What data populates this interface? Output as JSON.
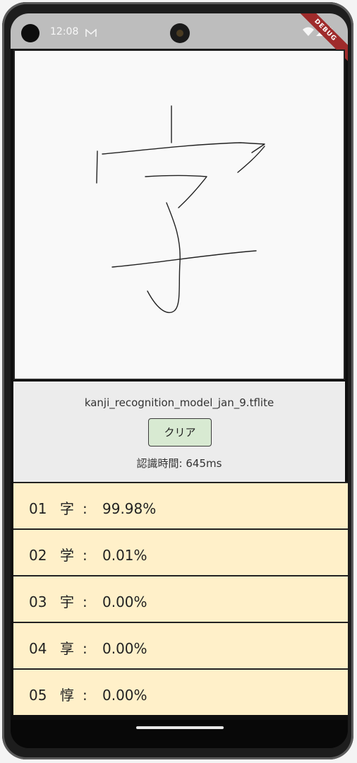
{
  "status": {
    "time": "12:08",
    "debug_label": "DEBUG"
  },
  "model": {
    "name": "kanji_recognition_model_jan_9.tflite"
  },
  "actions": {
    "clear_label": "クリア"
  },
  "recognition": {
    "time_text": "認識時間: 645ms"
  },
  "results": [
    {
      "rank": "01",
      "kanji": "字",
      "sep": ":",
      "prob": "99.98%"
    },
    {
      "rank": "02",
      "kanji": "学",
      "sep": ":",
      "prob": "0.01%"
    },
    {
      "rank": "03",
      "kanji": "宇",
      "sep": ":",
      "prob": "0.00%"
    },
    {
      "rank": "04",
      "kanji": "享",
      "sep": ":",
      "prob": "0.00%"
    },
    {
      "rank": "05",
      "kanji": "惇",
      "sep": ":",
      "prob": "0.00%"
    }
  ],
  "colors": {
    "result_bg": "#fff0c9",
    "button_bg": "#d8ead2",
    "panel_bg": "#ececec",
    "canvas_bg": "#f9f9f9"
  },
  "icons": [
    "mail-icon",
    "wifi-icon",
    "cell-signal-icon",
    "battery-icon"
  ]
}
